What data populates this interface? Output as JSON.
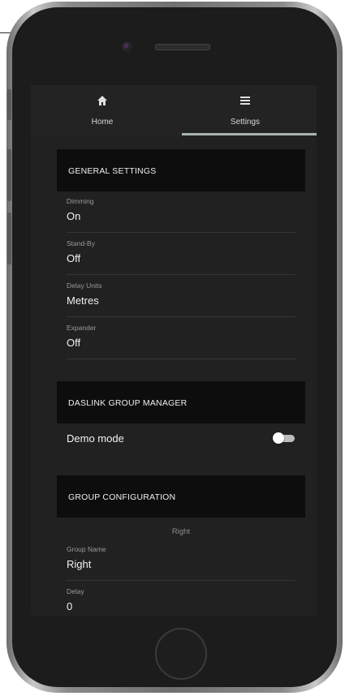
{
  "tabs": [
    {
      "label": "Home",
      "icon": "home-icon"
    },
    {
      "label": "Settings",
      "icon": "list-icon"
    }
  ],
  "active_tab": "Settings",
  "general_settings": {
    "title": "GENERAL SETTINGS",
    "fields": [
      {
        "label": "Dimming",
        "value": "On"
      },
      {
        "label": "Stand-By",
        "value": "Off"
      },
      {
        "label": "Delay Units",
        "value": "Metres"
      },
      {
        "label": "Expander",
        "value": "Off"
      }
    ]
  },
  "daslink": {
    "title": "DASLINK GROUP MANAGER",
    "demo_mode": {
      "label": "Demo mode",
      "enabled": false
    }
  },
  "group_configuration": {
    "title": "GROUP CONFIGURATION",
    "selected_group": "Right",
    "fields": [
      {
        "label": "Group Name",
        "value": "Right"
      },
      {
        "label": "Delay",
        "value": "0"
      }
    ]
  },
  "colors": {
    "screen_bg": "#212121",
    "section_header_bg": "#0d0d0d",
    "tab_indicator": "#a8b4b0",
    "text": "#f2f2f2",
    "label": "#9a9a9a"
  }
}
